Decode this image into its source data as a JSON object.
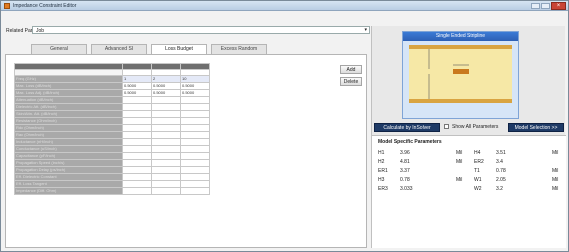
{
  "window": {
    "title": "Impedance Constraint Editor"
  },
  "related_part": {
    "label": "Related Part:",
    "value": "Job"
  },
  "tabs": [
    "General",
    "Advanced SI",
    "Loss Budget",
    "Excess Random"
  ],
  "grid": {
    "rows": [
      {
        "label": "",
        "values": [
          "",
          "",
          ""
        ]
      },
      {
        "label": "Freq (GHz)",
        "values": [
          "1",
          "2",
          "10"
        ],
        "style": "blue"
      },
      {
        "label": "Max. Loss (dB/inch)",
        "values": [
          "0.5000",
          "0.5000",
          "0.5000"
        ]
      },
      {
        "label": "Max. Loss Adj. (dB/inch)",
        "values": [
          "0.5000",
          "0.5000",
          "0.5000"
        ]
      },
      {
        "label": "Attenuation (dB/inch)",
        "values": [
          "",
          "",
          ""
        ]
      },
      {
        "label": "Dielectric Att. (dB/inch)",
        "values": [
          "",
          "",
          ""
        ]
      },
      {
        "label": "Skin/Attn. Att. (dB/inch)",
        "values": [
          "",
          "",
          ""
        ]
      },
      {
        "label": "Resistance (Ohm/inch)",
        "values": [
          "",
          "",
          ""
        ]
      },
      {
        "label": "Rdc (Ohm/inch)",
        "values": [
          "",
          "",
          ""
        ]
      },
      {
        "label": "Rac (Ohm/inch)",
        "values": [
          "",
          "",
          ""
        ]
      },
      {
        "label": "Inductance (nH/inch)",
        "values": [
          "",
          "",
          ""
        ]
      },
      {
        "label": "Conductance (uS/inch)",
        "values": [
          "",
          "",
          ""
        ]
      },
      {
        "label": "Capacitance (pF/inch)",
        "values": [
          "",
          "",
          ""
        ]
      },
      {
        "label": "Propagation Speed (inch/s)",
        "values": [
          "",
          "",
          ""
        ]
      },
      {
        "label": "Propagation Delay (ps/inch)",
        "values": [
          "",
          "",
          ""
        ]
      },
      {
        "label": "Eff. Dielectric Constant",
        "values": [
          "",
          "",
          ""
        ]
      },
      {
        "label": "Eff. Loss Tangent",
        "values": [
          "",
          "",
          ""
        ]
      },
      {
        "label": "Impedance (Diff. Ohm)",
        "values": [
          "",
          "",
          ""
        ]
      }
    ]
  },
  "buttons": {
    "add": "Add",
    "delete": "Delete"
  },
  "diagram": {
    "title": "Single Ended Stripline",
    "footer": ""
  },
  "calc": {
    "calculate": "Calculate by InSolver",
    "show_all": "Show All Parameters",
    "model_selection": "Model Selection >>"
  },
  "model_params": {
    "title": "Model Specific Parameters",
    "items": [
      {
        "name": "H1",
        "value": "3.96",
        "unit": "Mil"
      },
      {
        "name": "H4",
        "value": "3.51",
        "unit": "Mil"
      },
      {
        "name": "H2",
        "value": "4.81",
        "unit": "Mil"
      },
      {
        "name": "ER2",
        "value": "3.4",
        "unit": ""
      },
      {
        "name": "ER1",
        "value": "3.37",
        "unit": ""
      },
      {
        "name": "T1",
        "value": "0.78",
        "unit": "Mil"
      },
      {
        "name": "H3",
        "value": "0.78",
        "unit": "Mil"
      },
      {
        "name": "W1",
        "value": "2.05",
        "unit": "Mil"
      },
      {
        "name": "ER3",
        "value": "3.033",
        "unit": ""
      },
      {
        "name": "W2",
        "value": "3.2",
        "unit": "Mil"
      }
    ]
  }
}
